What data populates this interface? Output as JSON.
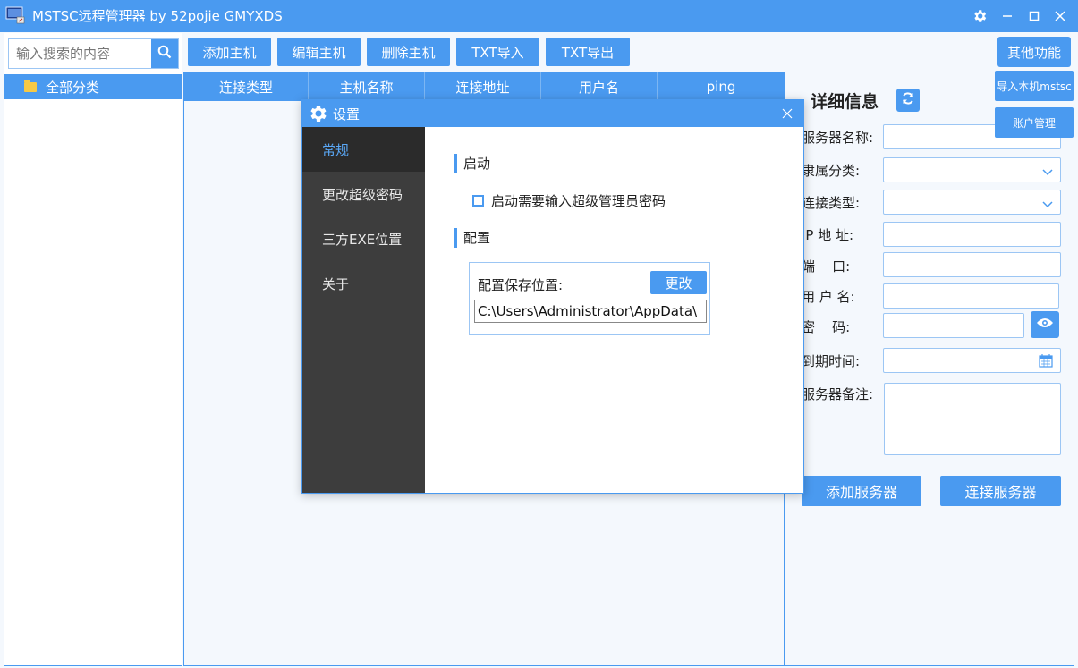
{
  "window": {
    "title": "MSTSC远程管理器 by 52pojie GMYXDS",
    "icon": "app-monitor-icon",
    "controls": [
      "gear-icon",
      "minimize-icon",
      "maximize-icon",
      "close-icon"
    ]
  },
  "search": {
    "placeholder": "输入搜索的内容",
    "value": ""
  },
  "tree": {
    "items": [
      {
        "label": "全部分类",
        "icon": "folder-icon",
        "selected": true
      }
    ]
  },
  "toolbar": {
    "add_host": "添加主机",
    "edit_host": "编辑主机",
    "delete_host": "删除主机",
    "txt_import": "TXT导入",
    "txt_export": "TXT导出",
    "other_functions": "其他功能"
  },
  "other_menu": {
    "import_local": "导入本机mstsc",
    "account_mgmt": "账户管理"
  },
  "table": {
    "columns": [
      "连接类型",
      "主机名称",
      "连接地址",
      "用户名",
      "ping"
    ],
    "rows": []
  },
  "detail": {
    "title": "详细信息",
    "labels": {
      "server_name": "服务器名称:",
      "category": "隶属分类:",
      "conn_type": "连接类型:",
      "ip": "IP 地 址:",
      "port": "端    口:",
      "username": "用 户 名:",
      "password": "密    码:",
      "expiry": "到期时间:",
      "remark": "服务器备注:"
    },
    "add_server": "添加服务器",
    "connect_server": "连接服务器"
  },
  "settings_dialog": {
    "title": "设置",
    "nav": [
      "常规",
      "更改超级密码",
      "三方EXE位置",
      "关于"
    ],
    "active_nav": 0,
    "startup_section": "启动",
    "require_password_label": "启动需要输入超级管理员密码",
    "require_password_checked": false,
    "config_section": "配置",
    "save_location_label": "配置保存位置:",
    "change_button": "更改",
    "save_path": "C:\\Users\\Administrator\\AppData\\"
  },
  "colors": {
    "accent": "#4a9af0",
    "nav_bg": "#3d3d3d",
    "nav_active": "#2b2b2b",
    "panel_bg": "#f4f8fd"
  }
}
